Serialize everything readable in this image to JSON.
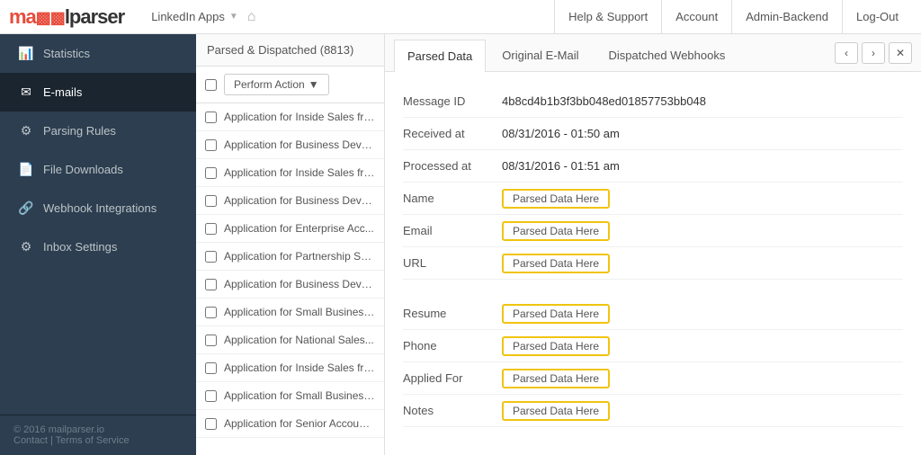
{
  "logo": {
    "text_red": "ma",
    "icon": "||",
    "text_dark": "lparser"
  },
  "top_nav": {
    "app_selector_label": "LinkedIn Apps",
    "home_icon": "⌂",
    "links": [
      {
        "label": "Help & Support",
        "name": "help-support"
      },
      {
        "label": "Account",
        "name": "account"
      },
      {
        "label": "Admin-Backend",
        "name": "admin-backend"
      },
      {
        "label": "Log-Out",
        "name": "logout"
      }
    ]
  },
  "sidebar": {
    "items": [
      {
        "label": "Statistics",
        "icon": "📊",
        "name": "statistics",
        "active": false
      },
      {
        "label": "E-mails",
        "icon": "✉",
        "name": "emails",
        "active": true
      },
      {
        "label": "Parsing Rules",
        "icon": "🔧",
        "name": "parsing-rules",
        "active": false
      },
      {
        "label": "File Downloads",
        "icon": "📄",
        "name": "file-downloads",
        "active": false
      },
      {
        "label": "Webhook Integrations",
        "icon": "🔗",
        "name": "webhook-integrations",
        "active": false
      },
      {
        "label": "Inbox Settings",
        "icon": "⚙",
        "name": "inbox-settings",
        "active": false
      }
    ],
    "footer_line1": "© 2016 mailparser.io",
    "footer_line2": "Contact | Terms of Service"
  },
  "email_list": {
    "header": "Parsed & Dispatched (8813)",
    "perform_action_label": "Perform Action",
    "items": [
      "Application for Inside Sales fro...",
      "Application for Business Deve...",
      "Application for Inside Sales fro...",
      "Application for Business Deve...",
      "Application for Enterprise Acc...",
      "Application for Partnership Sa...",
      "Application for Business Deve...",
      "Application for Small Business...",
      "Application for National Sales...",
      "Application for Inside Sales fro...",
      "Application for Small Business...",
      "Application for Senior Account..."
    ]
  },
  "detail": {
    "tabs": [
      {
        "label": "Parsed Data",
        "active": true,
        "name": "tab-parsed-data"
      },
      {
        "label": "Original E-Mail",
        "active": false,
        "name": "tab-original-email"
      },
      {
        "label": "Dispatched Webhooks",
        "active": false,
        "name": "tab-dispatched-webhooks"
      }
    ],
    "nav_prev_icon": "‹",
    "nav_next_icon": "›",
    "nav_close_icon": "✕",
    "fields": [
      {
        "label": "Message ID",
        "value": "4b8cd4b1b3f3bb048ed01857753bb048",
        "type": "text"
      },
      {
        "label": "Received at",
        "value": "08/31/2016 - 01:50 am",
        "type": "text"
      },
      {
        "label": "Processed at",
        "value": "08/31/2016 - 01:51 am",
        "type": "text"
      },
      {
        "label": "Name",
        "value": "Parsed Data Here",
        "type": "parsed"
      },
      {
        "label": "Email",
        "value": "Parsed Data Here",
        "type": "parsed"
      },
      {
        "label": "URL",
        "value": "Parsed Data Here",
        "type": "parsed"
      },
      {
        "label": "_spacer_",
        "value": "",
        "type": "spacer"
      },
      {
        "label": "Resume",
        "value": "Parsed Data Here",
        "type": "parsed"
      },
      {
        "label": "Phone",
        "value": "Parsed Data Here",
        "type": "parsed"
      },
      {
        "label": "Applied For",
        "value": "Parsed Data Here",
        "type": "parsed"
      },
      {
        "label": "Notes",
        "value": "Parsed Data Here",
        "type": "parsed"
      }
    ]
  }
}
